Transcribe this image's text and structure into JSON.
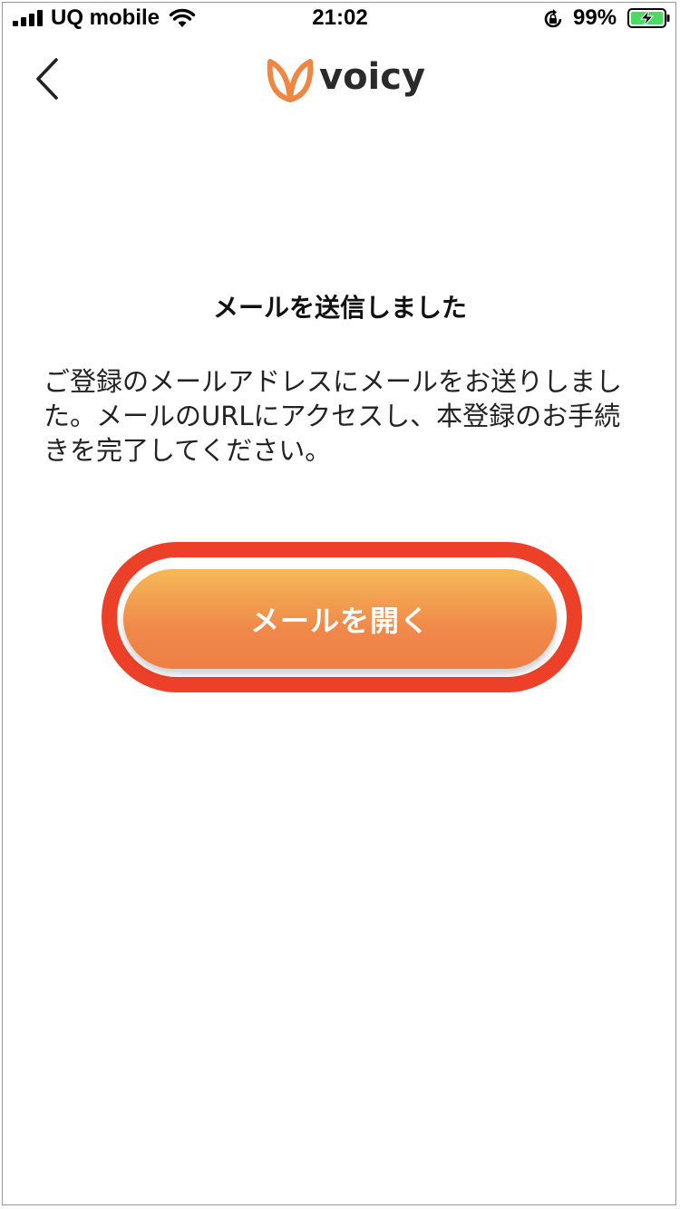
{
  "status_bar": {
    "carrier": "UQ mobile",
    "time": "21:02",
    "battery_percent": "99%",
    "icons": [
      "signal-bars-icon",
      "wifi-icon",
      "orientation-lock-icon",
      "battery-charging-icon"
    ]
  },
  "header": {
    "back_icon": "chevron-left-icon",
    "logo_text": "voicy",
    "brand_color": "#ef8643"
  },
  "main": {
    "title": "メールを送信しました",
    "description": "ご登録のメールアドレスにメールをお送りしました。メールのURLにアクセスし、本登録のお手続きを完了してください。",
    "open_mail_button": "メールを開く",
    "highlight_color": "#ec4128"
  }
}
